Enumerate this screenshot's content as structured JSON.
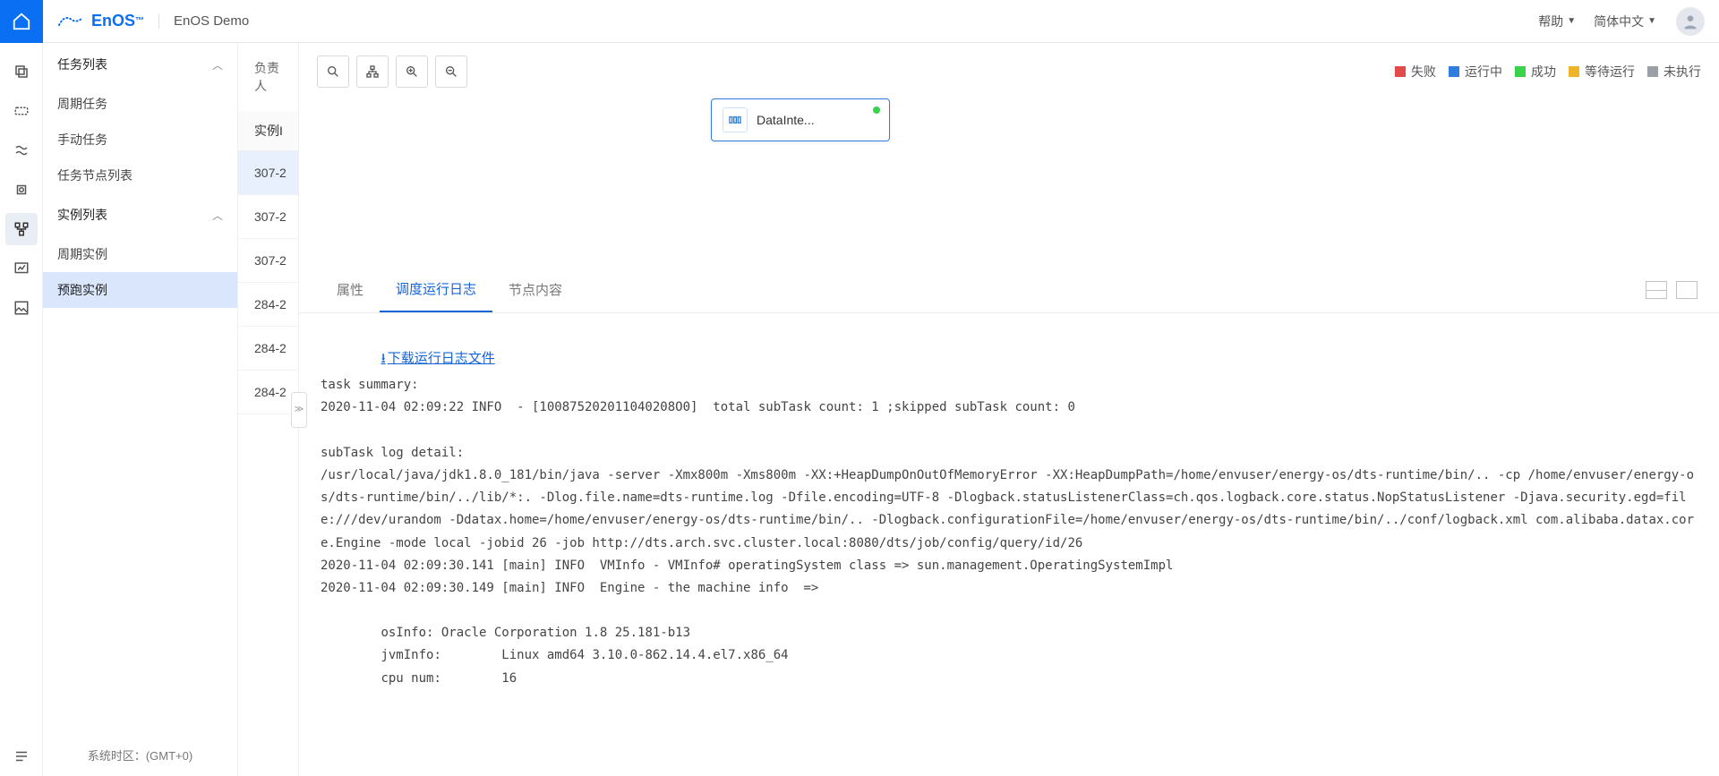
{
  "header": {
    "brand": "EnOS",
    "tm": "™",
    "title": "EnOS Demo",
    "help": "帮助",
    "lang": "简体中文"
  },
  "sidenav": {
    "group_tasks": "任务列表",
    "item_periodic_tasks": "周期任务",
    "item_manual_tasks": "手动任务",
    "item_task_nodes": "任务节点列表",
    "group_instances": "实例列表",
    "item_periodic_instances": "周期实例",
    "item_prerun_instances": "预跑实例",
    "footer": "系统时区：(GMT+0)"
  },
  "instcol": {
    "owner_label": "负责人",
    "header": "实例I",
    "rows": [
      "307-2",
      "307-2",
      "307-2",
      "284-2",
      "284-2",
      "284-2"
    ],
    "selected_index": 0
  },
  "legend": {
    "fail": "失败",
    "running": "运行中",
    "success": "成功",
    "waiting": "等待运行",
    "not_exec": "未执行"
  },
  "colors": {
    "fail": "#e24a4a",
    "running": "#2f7de1",
    "success": "#3ad24a",
    "waiting": "#f0b429",
    "not_exec": "#9aa0a6"
  },
  "dag": {
    "node_label": "DataInte..."
  },
  "tabs": {
    "attrs": "属性",
    "log": "调度运行日志",
    "content": "节点内容"
  },
  "log": {
    "download": "下载运行日志文件",
    "text": "task summary:\n2020-11-04 02:09:22 INFO  - [100875202011040208O0]  total subTask count: 1 ;skipped subTask count: 0\n\nsubTask log detail:\n/usr/local/java/jdk1.8.0_181/bin/java -server -Xmx800m -Xms800m -XX:+HeapDumpOnOutOfMemoryError -XX:HeapDumpPath=/home/envuser/energy-os/dts-runtime/bin/.. -cp /home/envuser/energy-os/dts-runtime/bin/../lib/*:. -Dlog.file.name=dts-runtime.log -Dfile.encoding=UTF-8 -Dlogback.statusListenerClass=ch.qos.logback.core.status.NopStatusListener -Djava.security.egd=file:///dev/urandom -Ddatax.home=/home/envuser/energy-os/dts-runtime/bin/.. -Dlogback.configurationFile=/home/envuser/energy-os/dts-runtime/bin/../conf/logback.xml com.alibaba.datax.core.Engine -mode local -jobid 26 -job http://dts.arch.svc.cluster.local:8080/dts/job/config/query/id/26\n2020-11-04 02:09:30.141 [main] INFO  VMInfo - VMInfo# operatingSystem class => sun.management.OperatingSystemImpl\n2020-11-04 02:09:30.149 [main] INFO  Engine - the machine info  =>\n\n        osInfo: Oracle Corporation 1.8 25.181-b13\n        jvmInfo:        Linux amd64 3.10.0-862.14.4.el7.x86_64\n        cpu num:        16"
  }
}
